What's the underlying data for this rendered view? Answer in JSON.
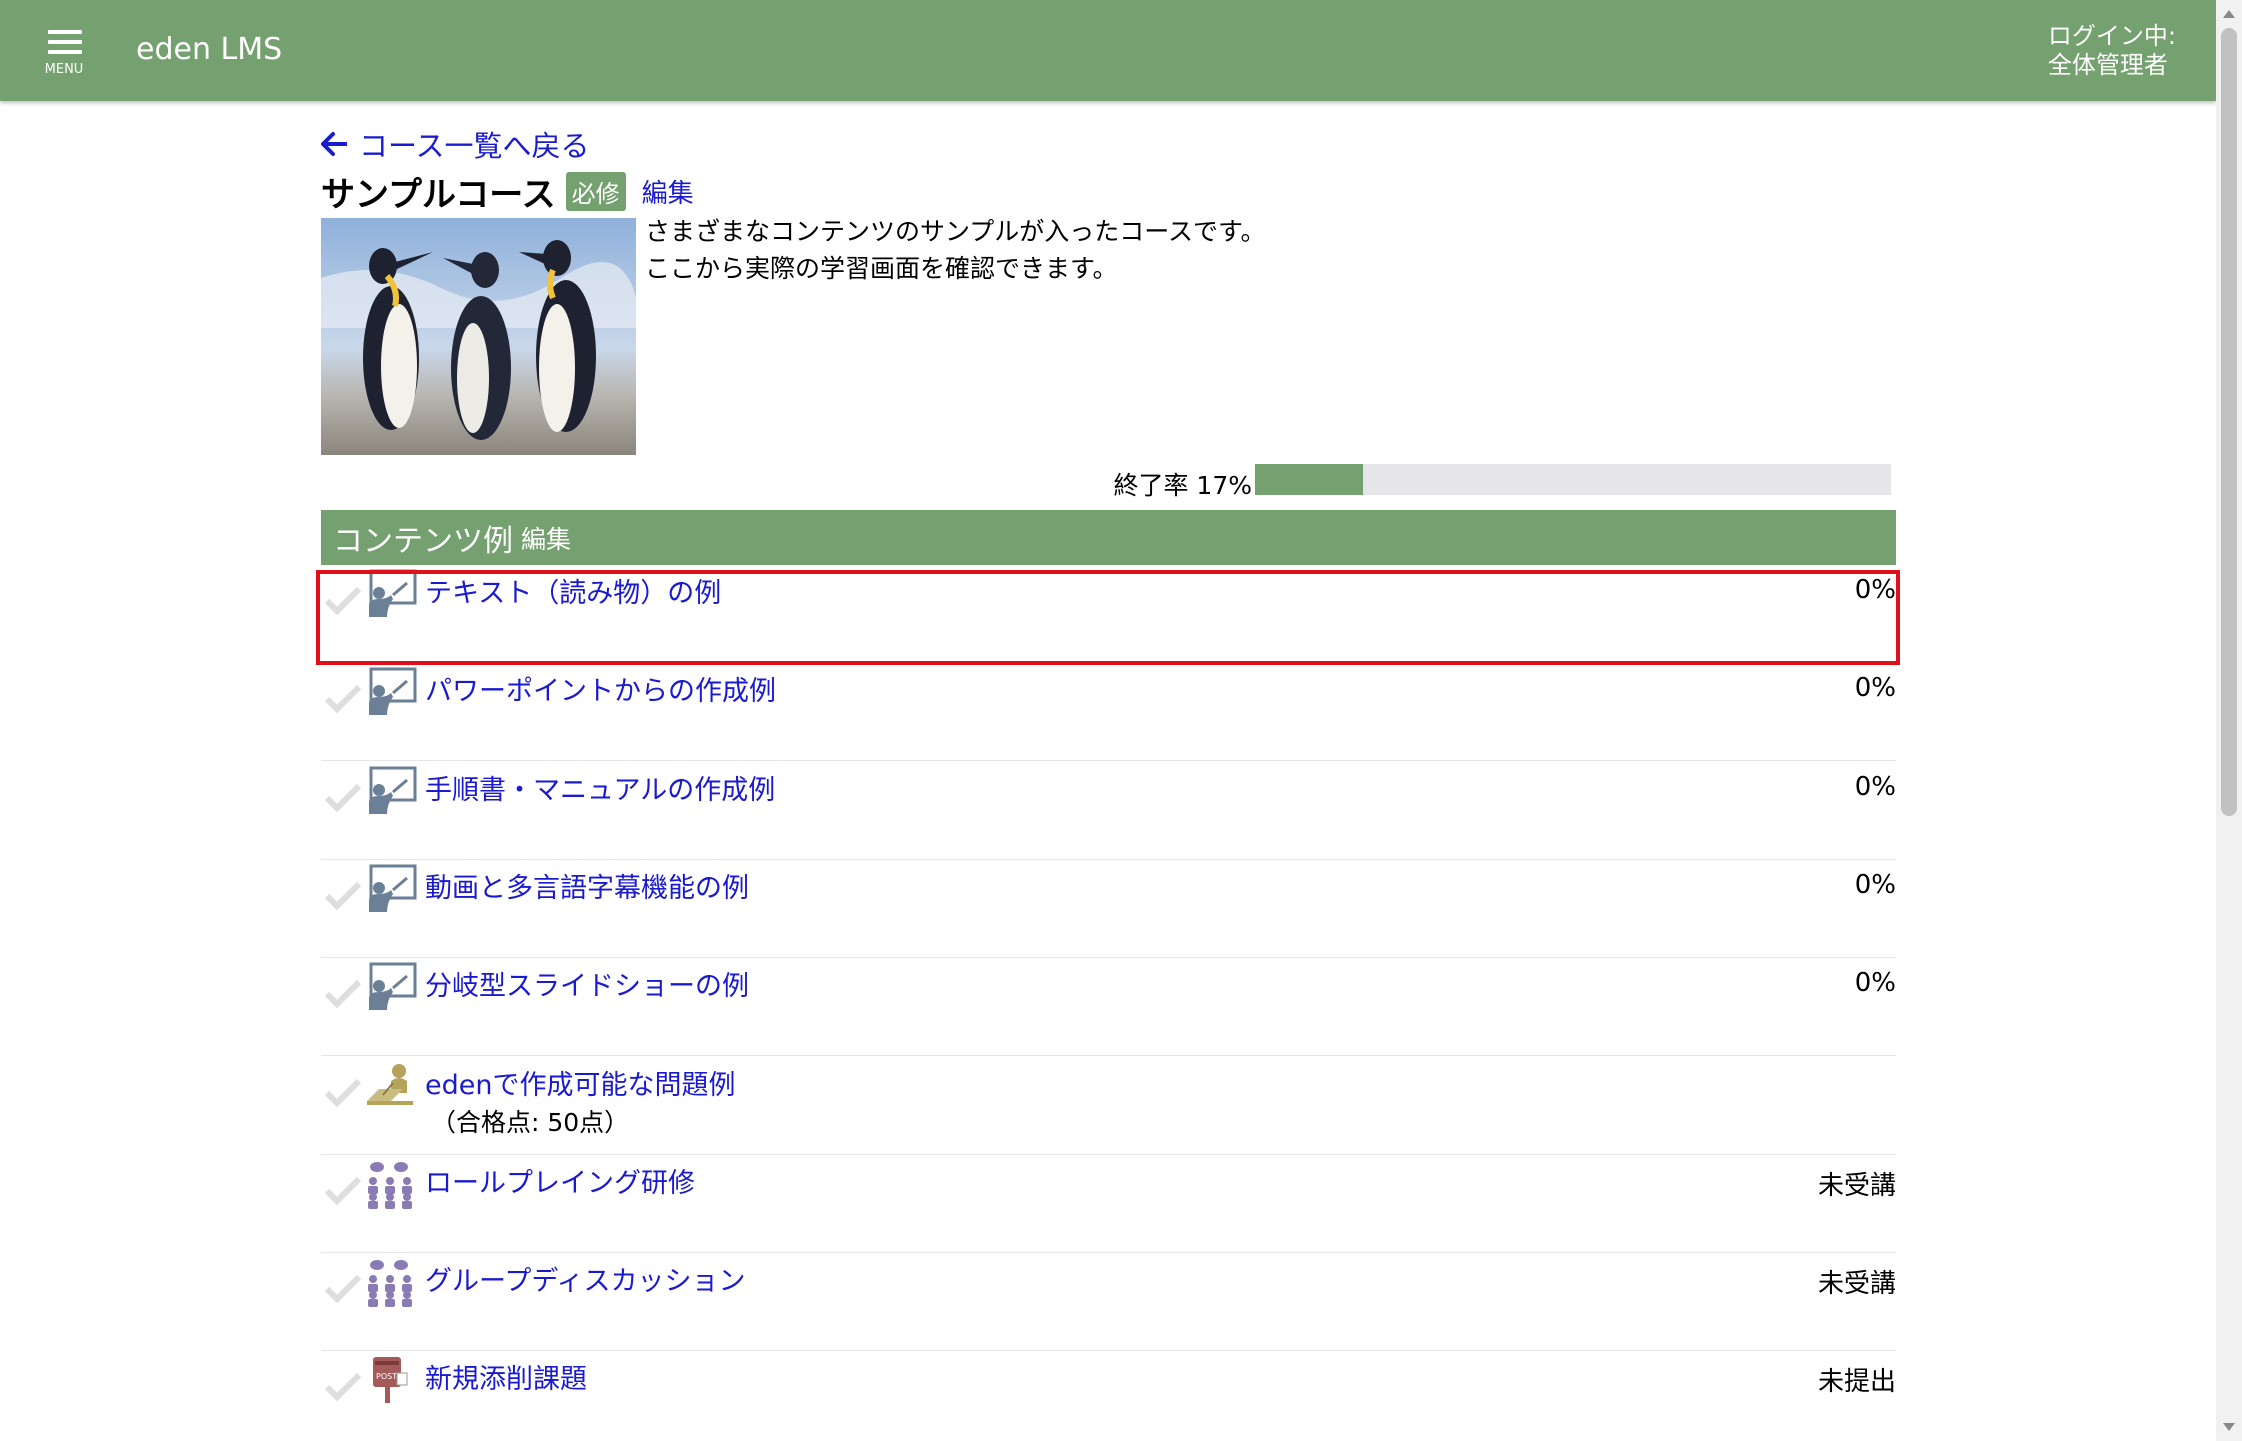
{
  "header": {
    "menu_label": "MENU",
    "app_title": "eden LMS",
    "login_line1": "ログイン中:",
    "login_line2": "全体管理者",
    "bar_color": "#75a06f"
  },
  "course": {
    "back_label": "コース一覧へ戻る",
    "title": "サンプルコース",
    "badge": "必修",
    "edit_label": "編集",
    "image_alt": "ペンギン",
    "description_line1": "さまざまなコンテンツのサンプルが入ったコースです。",
    "description_line2": "ここから実際の学習画面を確認できます。",
    "progress_label": "終了率 17%",
    "progress_value": 0.17
  },
  "section": {
    "title": "コンテンツ例",
    "edit_label": "編集"
  },
  "items": [
    {
      "title": "テキスト（読み物）の例",
      "status": "0%",
      "icon": "lecture-icon",
      "highlighted": true
    },
    {
      "title": "パワーポイントからの作成例",
      "status": "0%",
      "icon": "lecture-icon"
    },
    {
      "title": "手順書・マニュアルの作成例",
      "status": "0%",
      "icon": "lecture-icon"
    },
    {
      "title": "動画と多言語字幕機能の例",
      "status": "0%",
      "icon": "lecture-icon"
    },
    {
      "title": "分岐型スライドショーの例",
      "status": "0%",
      "icon": "lecture-icon"
    },
    {
      "title": "edenで作成可能な問題例",
      "sub": "（合格点: 50点）",
      "status": "",
      "icon": "exam-icon"
    },
    {
      "title": "ロールプレイング研修",
      "status": "未受講",
      "icon": "group-icon"
    },
    {
      "title": "グループディスカッション",
      "status": "未受講",
      "icon": "group-icon"
    },
    {
      "title": "新規添削課題",
      "status": "未提出",
      "icon": "post-icon"
    }
  ],
  "colors": {
    "accent": "#75a06f",
    "link": "#1a1ad0",
    "highlight": "#e0101a"
  }
}
